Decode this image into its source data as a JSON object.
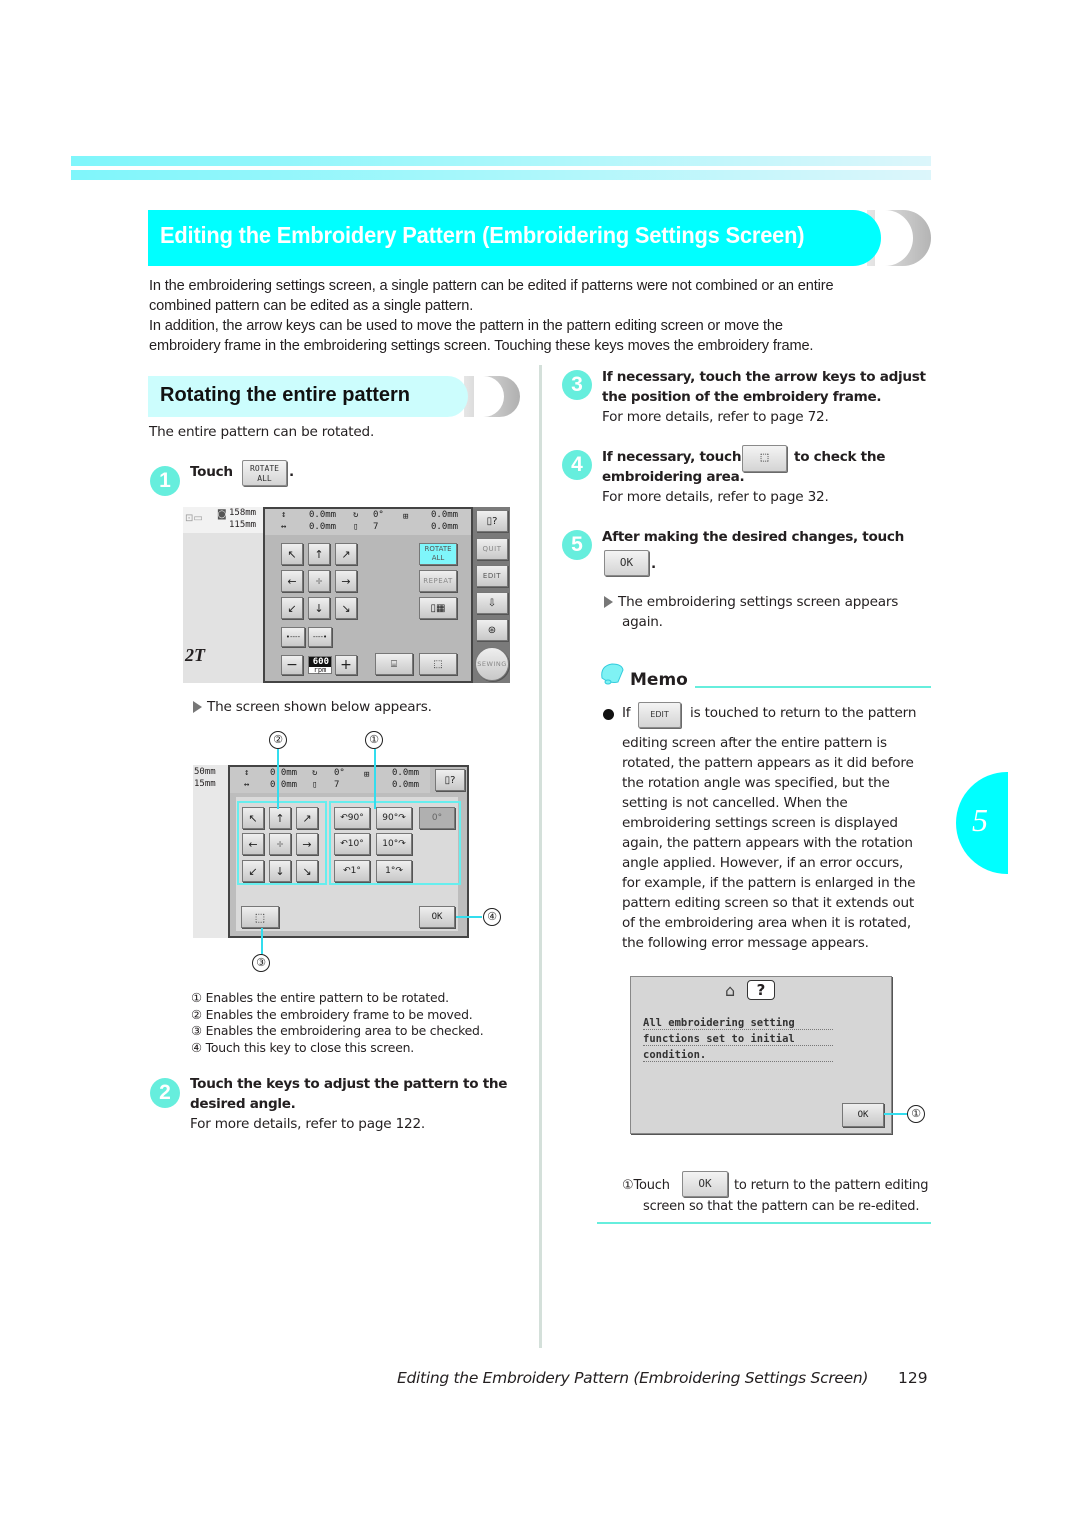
{
  "header": {
    "title": "Editing the Embroidery Pattern (Embroidering Settings Screen)",
    "intro": [
      "In the embroidering settings screen, a single pattern can be edited if patterns were not combined or an entire",
      "combined pattern can be edited as a single pattern.",
      "In addition, the arrow keys can be used to move the pattern in the pattern editing screen or move the",
      "embroidery frame in the embroidering settings screen. Touching these keys moves the embroidery frame."
    ]
  },
  "section": {
    "title": "Rotating the entire pattern",
    "lead": "The entire pattern can be rotated."
  },
  "steps": [
    {
      "num": "1",
      "text": "Touch",
      "key": "ROTATE ALL",
      "after": "."
    },
    {
      "num": "2",
      "line1": "Touch the keys to adjust the pattern to the",
      "line2": "desired angle.",
      "ref": "For more details, refer to page 122."
    },
    {
      "num": "3",
      "line1": "If necessary, touch the arrow keys to adjust",
      "line2": "the position of the embroidery frame.",
      "ref": "For more details, refer to page 72."
    },
    {
      "num": "4",
      "line1a": "If necessary, touch",
      "line1b": "to check the",
      "line2": "embroidering area.",
      "ref": "For more details, refer to page 32."
    },
    {
      "num": "5",
      "line1": "After making the desired changes, touch",
      "key": "OK",
      "after": ".",
      "result1": "The embroidering settings screen appears",
      "result2": "again."
    }
  ],
  "screen1": {
    "size_h": "158mm",
    "size_w": "115mm",
    "readout": {
      "v_offset": "0.0mm",
      "h_offset": "0.0mm",
      "angle": "0°",
      "colors": "7",
      "v_size": "0.0mm",
      "h_size": "0.0mm"
    },
    "buttons": {
      "rotate_all": "ROTATE\nALL",
      "repeat": "REPEAT",
      "quit": "QUIT",
      "edit": "EDIT",
      "sewing": "SEWING",
      "speed": "600",
      "speed_unit": "rpm",
      "minus": "−",
      "plus": "+"
    },
    "partial_text": "2T"
  },
  "result_after_step1": "The screen shown below appears.",
  "screen2": {
    "size_h": "50mm",
    "size_w": "15mm",
    "readout": {
      "v_offset": "0.0mm",
      "h_offset": "0.0mm",
      "angle": "0°",
      "colors": "7",
      "v_size": "0.0mm",
      "h_size": "0.0mm"
    },
    "rotate_keys": [
      "90°",
      "90°",
      "0°",
      "10°",
      "10°",
      "1°",
      "1°"
    ],
    "ok": "OK",
    "callouts": [
      "①",
      "②",
      "③",
      "④"
    ]
  },
  "legend": [
    "① Enables the entire pattern to be rotated.",
    "② Enables the embroidery frame to be moved.",
    "③ Enables the embroidering area to be checked.",
    "④ Touch this key to close this screen."
  ],
  "memo": {
    "title": "Memo",
    "if": "If",
    "key": "EDIT",
    "line1": "is touched to return to the pattern",
    "lines": [
      "editing screen after the entire pattern is",
      "rotated, the pattern appears as it did before",
      "the rotation angle was specified, but the",
      "setting is not cancelled. When the",
      "embroidering settings screen is displayed",
      "again, the pattern appears with the rotation",
      "angle applied. However, if an error occurs,",
      "for example, if the pattern is enlarged in the",
      "pattern editing screen so that it extends out",
      "of the embroidering area when it is rotated,",
      "the following error message appears."
    ],
    "error_dialog": {
      "lines": [
        "All embroidering setting",
        "functions set to initial",
        "condition."
      ],
      "ok": "OK",
      "callout": "①"
    },
    "note_prefix": "①Touch",
    "note_key": "OK",
    "note_line1": "to return to the pattern editing",
    "note_line2": "screen so that the pattern can be re-edited."
  },
  "chapter_tab": "5",
  "footer": {
    "running_title": "Editing the Embroidery Pattern (Embroidering Settings Screen)",
    "page": "129"
  }
}
